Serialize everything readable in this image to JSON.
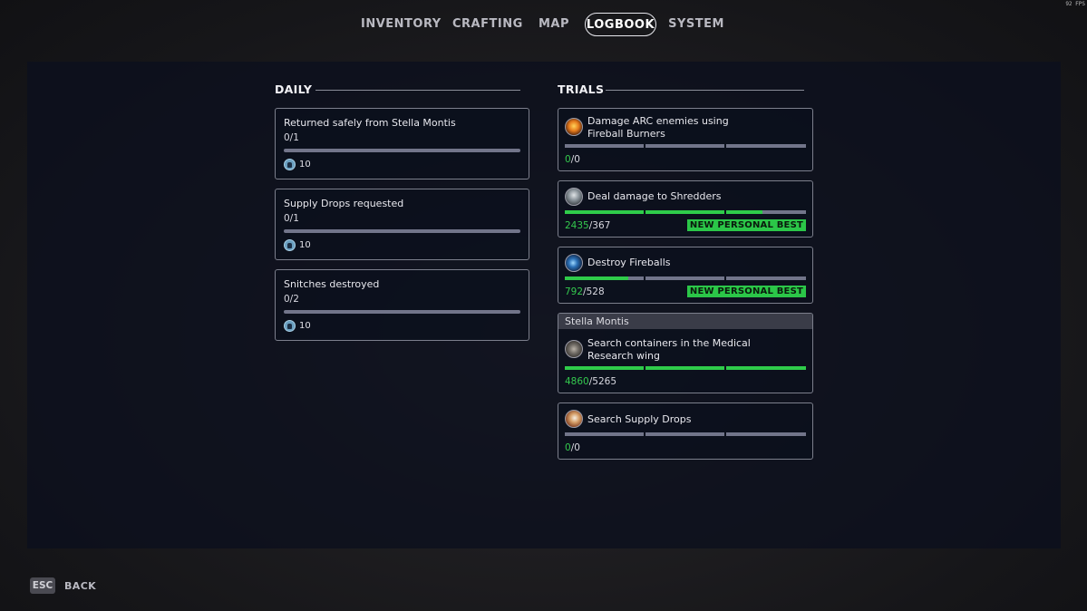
{
  "fps": "92 FPS",
  "nav": {
    "items": [
      {
        "label": "INVENTORY"
      },
      {
        "label": "CRAFTING"
      },
      {
        "label": "MAP"
      },
      {
        "label": "LOGBOOK",
        "active": true
      },
      {
        "label": "SYSTEM"
      }
    ]
  },
  "daily": {
    "heading": "DAILY",
    "items": [
      {
        "title": "Returned safely from Stella Montis",
        "progress": "0/1",
        "progress_fraction": 0,
        "reward": "10",
        "reward_icon": "coin-icon"
      },
      {
        "title": "Supply Drops requested",
        "progress": "0/1",
        "progress_fraction": 0,
        "reward": "10",
        "reward_icon": "coin-icon"
      },
      {
        "title": "Snitches destroyed",
        "progress": "0/2",
        "progress_fraction": 0,
        "reward": "10",
        "reward_icon": "coin-icon"
      }
    ]
  },
  "trials": {
    "heading": "TRIALS",
    "items": [
      {
        "title": "Damage ARC enemies using Fireball Burners",
        "current": "0",
        "target": "0",
        "icon": "fireball-burner-icon",
        "badge": "",
        "segment_fill": [
          0,
          0,
          0
        ]
      },
      {
        "title": "Deal damage to Shredders",
        "current": "2435",
        "target": "367",
        "icon": "shredder-icon",
        "badge": "NEW PERSONAL BEST",
        "segment_fill": [
          1,
          1,
          0.45
        ]
      },
      {
        "title": "Destroy Fireballs",
        "current": "792",
        "target": "528",
        "icon": "fireball-icon",
        "badge": "NEW PERSONAL BEST",
        "segment_fill": [
          0.8,
          0,
          0
        ]
      }
    ],
    "group": {
      "name": "Stella Montis",
      "items": [
        {
          "title": "Search containers in the Medical Research wing",
          "current": "4860",
          "target": "5265",
          "icon": "medical-container-icon",
          "badge": "",
          "segment_fill": [
            1,
            1,
            1
          ]
        }
      ]
    },
    "last": {
      "title": "Search Supply Drops",
      "current": "0",
      "target": "0",
      "icon": "supply-drop-icon",
      "badge": "",
      "segment_fill": [
        0,
        0,
        0
      ]
    }
  },
  "footer": {
    "key": "ESC",
    "label": "BACK"
  },
  "colors": {
    "accent_green": "#2fcc4a",
    "bar_track": "#72758a",
    "panel": "#0c101e"
  }
}
